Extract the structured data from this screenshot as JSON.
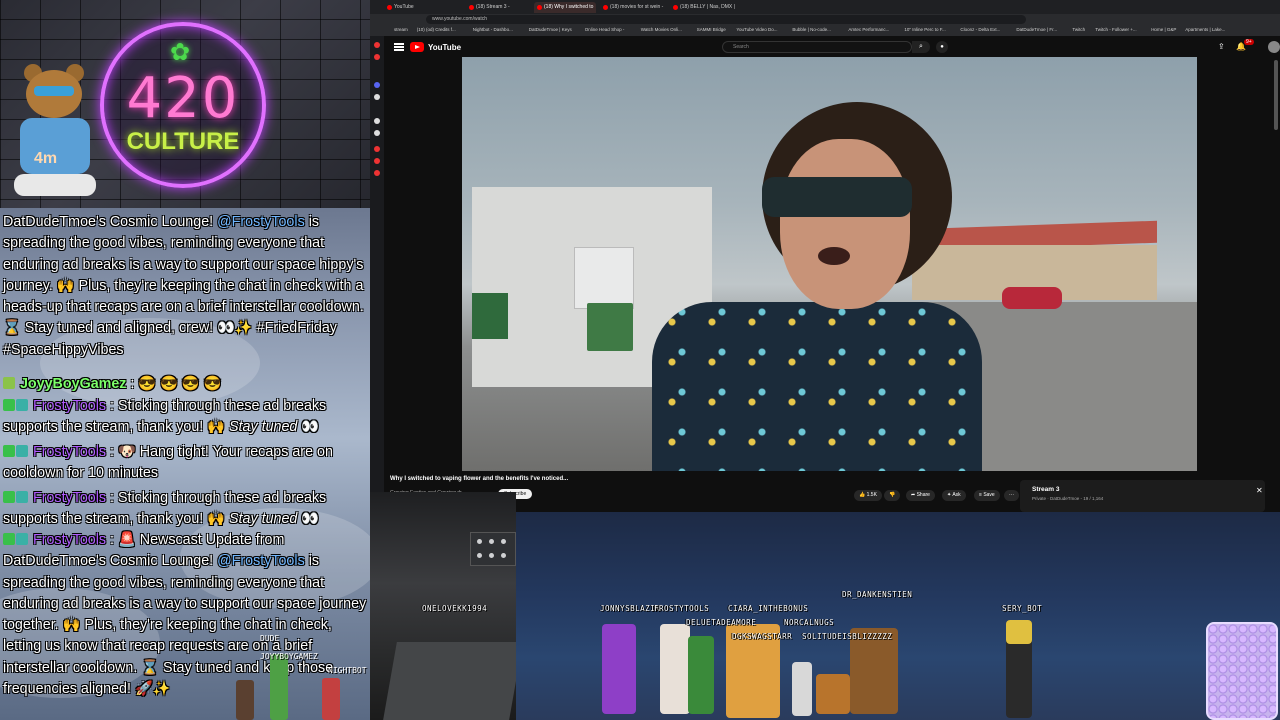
{
  "overlay": {
    "logo_number": "420",
    "logo_word": "CULTURE",
    "bear_counter": "4m",
    "chat": [
      {
        "parts": [
          {
            "t": "DatDudeTmoe's Cosmic Lounge! "
          },
          {
            "t": "@FrostyTools",
            "c": "at"
          },
          {
            "t": " is spreading the good vibes, reminding everyone that enduring ad breaks is a way to support our space hippy's journey. 🙌 Plus, they're keeping the chat in check with a heads-up that recaps are on a brief interstellar cooldown. ⌛ Stay tuned and aligned, crew! 👀✨ #FriedFriday #SpaceHippyVibes"
          }
        ]
      },
      {
        "user": "JoyyBoyGamez",
        "userclass": "user-g",
        "parts": [
          {
            "t": " : 😎 😎 😎 😎"
          }
        ]
      },
      {
        "user": "FrostyTools",
        "userclass": "user-p",
        "parts": [
          {
            "t": " : Sticking through these ad breaks supports the stream, thank you! 🙌 "
          },
          {
            "t": "Stay tuned",
            "c": "em"
          },
          {
            "t": " 👀"
          }
        ]
      },
      {
        "user": "FrostyTools",
        "userclass": "user-p",
        "parts": [
          {
            "t": " : 🐶 Hang tight! Your recaps are on cooldown for 10 minutes"
          }
        ]
      },
      {
        "user": "FrostyTools",
        "userclass": "user-p",
        "parts": [
          {
            "t": " : Sticking through these ad breaks supports the stream, thank you! 🙌 "
          },
          {
            "t": "Stay tuned",
            "c": "em"
          },
          {
            "t": " 👀"
          }
        ]
      },
      {
        "user": "FrostyTools",
        "userclass": "user-p",
        "parts": [
          {
            "t": " : 🚨 Newscast Update from DatDudeTmoe's Cosmic Lounge! "
          },
          {
            "t": "@FrostyTools",
            "c": "at"
          },
          {
            "t": " is spreading the good vibes, reminding everyone that enduring ad breaks is a way to support our space journey together. 🙌 Plus, they're keeping the chat in check, letting us know that recap requests are on a brief interstellar cooldown. ⌛ Stay tuned and keep those frequencies aligned! 🚀✨"
          }
        ]
      }
    ],
    "sprite_names": [
      "DUDE",
      "JOYYBOYGAMEZ",
      "NIGHTBOT"
    ]
  },
  "browser": {
    "tabs": [
      {
        "label": "YouTube",
        "active": false
      },
      {
        "label": "(18) Stream 3 - YouTube",
        "active": false
      },
      {
        "label": "(18) Why I switched to",
        "active": true
      },
      {
        "label": "(18) movies for st wein - Y",
        "active": false
      },
      {
        "label": "(18) BELLY | Nas, DMX | Fi",
        "active": false
      }
    ],
    "url": "www.youtube.com/watch",
    "bookmarks": [
      "stream",
      "(10) (od) Credits f...",
      "Nightbot - Dashbo...",
      "DatDudeTmoe | Keys",
      "Online Head Shop -",
      "Watch Movies Onli...",
      "SAMMI Bridge",
      "YouTube Video Do...",
      "Bubble | No-code...",
      "Amtec Performanc...",
      "10\" Inline Perc to F...",
      "Cloonz - Delta Ext...",
      "DatDudeTmoe | Fr...",
      "Twitch",
      "Twitch - Follower +...",
      "Home | G&P",
      "Apartments | Lake..."
    ],
    "yt_brand": "YouTube",
    "search_placeholder": "Search",
    "notif_count": "9+",
    "video_title": "Why I switched to vaping flower and the benefits I've noticed...",
    "channel_line": "Growing Exotics and Growing dr...",
    "subscribe_label": "Subscribe",
    "like_count": "1.5K",
    "share_label": "Share",
    "ask_label": "Ask",
    "save_label": "Save",
    "more_label": "···",
    "playlist_title": "Stream 3",
    "playlist_sub": "Private · DatDudeTmoe - 19 / 1,164"
  },
  "scene": {
    "names": [
      {
        "n": "JONNYSBLAZIN"
      },
      {
        "n": "FROSTYTOOLS"
      },
      {
        "n": "CIARA_INTHEBONUS"
      },
      {
        "n": "DELUETADEAMORE"
      },
      {
        "n": "DGKSWAGSTARR"
      },
      {
        "n": "NORCALNUGS"
      },
      {
        "n": "SOLITUDEISBLIZZZZZ"
      },
      {
        "n": "DR_DANKENSTIEN"
      },
      {
        "n": "SERY_BOT"
      },
      {
        "n": "ONELOVEKK1994"
      }
    ]
  },
  "colors": {
    "accent": "#ff0000",
    "mention": "#6fb6ff",
    "user_purple": "#b05cff",
    "user_green": "#7cff6a"
  }
}
